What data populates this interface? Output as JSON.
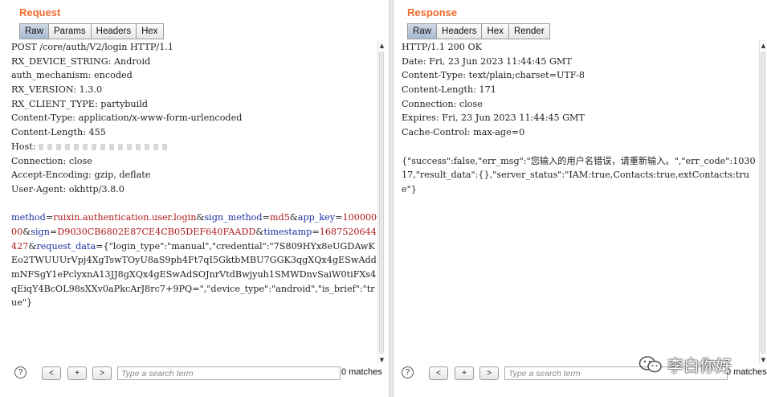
{
  "request": {
    "title": "Request",
    "tabs": [
      "Raw",
      "Params",
      "Headers",
      "Hex"
    ],
    "lines": [
      "POST /core/auth/V2/login HTTP/1.1",
      "RX_DEVICE_STRING: Android",
      "auth_mechanism: encoded",
      "RX_VERSION: 1.3.0",
      "RX_CLIENT_TYPE: partybuild",
      "Content-Type: application/x-www-form-urlencoded",
      "Content-Length: 455",
      "Host: ",
      "Connection: close",
      "Accept-Encoding: gzip, deflate",
      "User-Agent: okhttp/3.8.0"
    ],
    "body": [
      {
        "k": "method",
        "v": "ruixin.authentication.user.login"
      },
      {
        "k": "sign_method",
        "v": "md5"
      },
      {
        "k": "app_key",
        "v": "10000000"
      },
      {
        "k": "sign",
        "v": "D9030CB6802E87CE4CB05DEF640FAADD"
      },
      {
        "k": "timestamp",
        "v": "1687520644427"
      },
      {
        "k": "request_data",
        "v": "{\"login_type\":\"manual\",\"credential\":\"7S809HYx8eUGDAwKEo2TWUUUrVpj4XgTswTOyU8aS9ph4Ft7qI5GktbMBU7GGK3qgXQx4gESwAddmNFSgY1ePclyxnA13JJ8gXQx4gESwAdSOJnrVtdBwjyuh1SMWDnvSaiW0tiFXs4qEiqY4BcOL98sXXv0aPkcArJ8rc7+9PQ=\",\"device_type\":\"android\",\"is_brief\":\"true\"}"
      }
    ],
    "search_placeholder": "Type a search term",
    "matches": "0 matches",
    "help": "?",
    "prev": "<",
    "plus": "+",
    "next": ">"
  },
  "response": {
    "title": "Response",
    "tabs": [
      "Raw",
      "Headers",
      "Hex",
      "Render"
    ],
    "lines": [
      "HTTP/1.1 200 OK",
      "Date: Fri, 23 Jun 2023 11:44:45 GMT",
      "Content-Type: text/plain;charset=UTF-8",
      "Content-Length: 171",
      "Connection: close",
      "Expires: Fri, 23 Jun 2023 11:44:45 GMT",
      "Cache-Control: max-age=0"
    ],
    "body": "{\"success\":false,\"err_msg\":\"您输入的用户名错误，请重新输入。\",\"err_code\":103017,\"result_data\":{},\"server_status\":\"IAM:true,Contacts:true,extContacts:true\"}",
    "search_placeholder": "Type a search term",
    "matches": "0 matches",
    "help": "?",
    "prev": "<",
    "plus": "+",
    "next": ">"
  },
  "watermark": "李白你好",
  "colors": {
    "title": "#f06a2e",
    "param_key": "#1a2fa0",
    "param_value": "#b01818",
    "active_tab": "#b5c5d9"
  },
  "icons": {
    "watermark": "wechat-icon"
  }
}
